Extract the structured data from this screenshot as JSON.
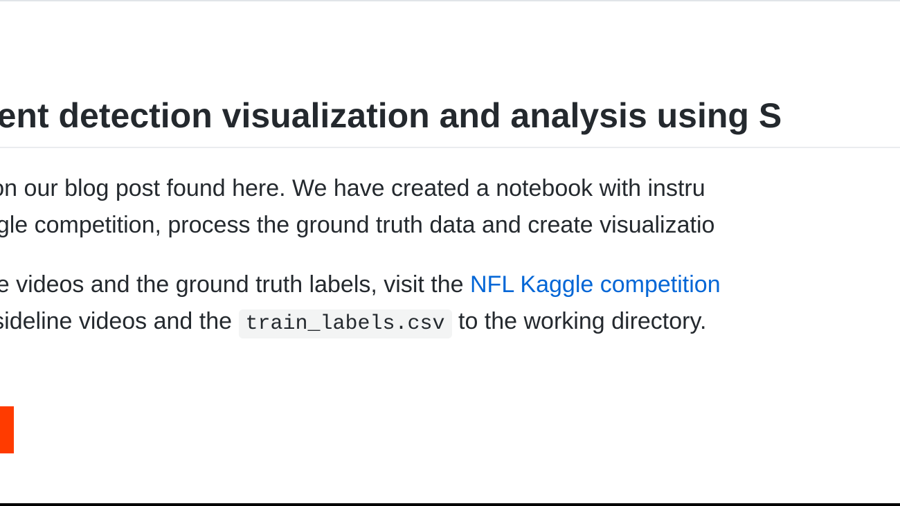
{
  "heading": "event detection visualization and analysis using S",
  "paragraph1": {
    "line1": "ed on our blog post found here. We have created a notebook with instru",
    "line2": "kaggle competition, process the ground truth data and create visualizatio"
  },
  "paragraph2": {
    "prefix": "mple videos and the ground truth labels, visit the ",
    "link_text": "NFL Kaggle competition",
    "line2_prefix": "ne-sideline videos and the ",
    "code_text": "train_labels.csv",
    "line2_suffix": " to the working directory."
  }
}
